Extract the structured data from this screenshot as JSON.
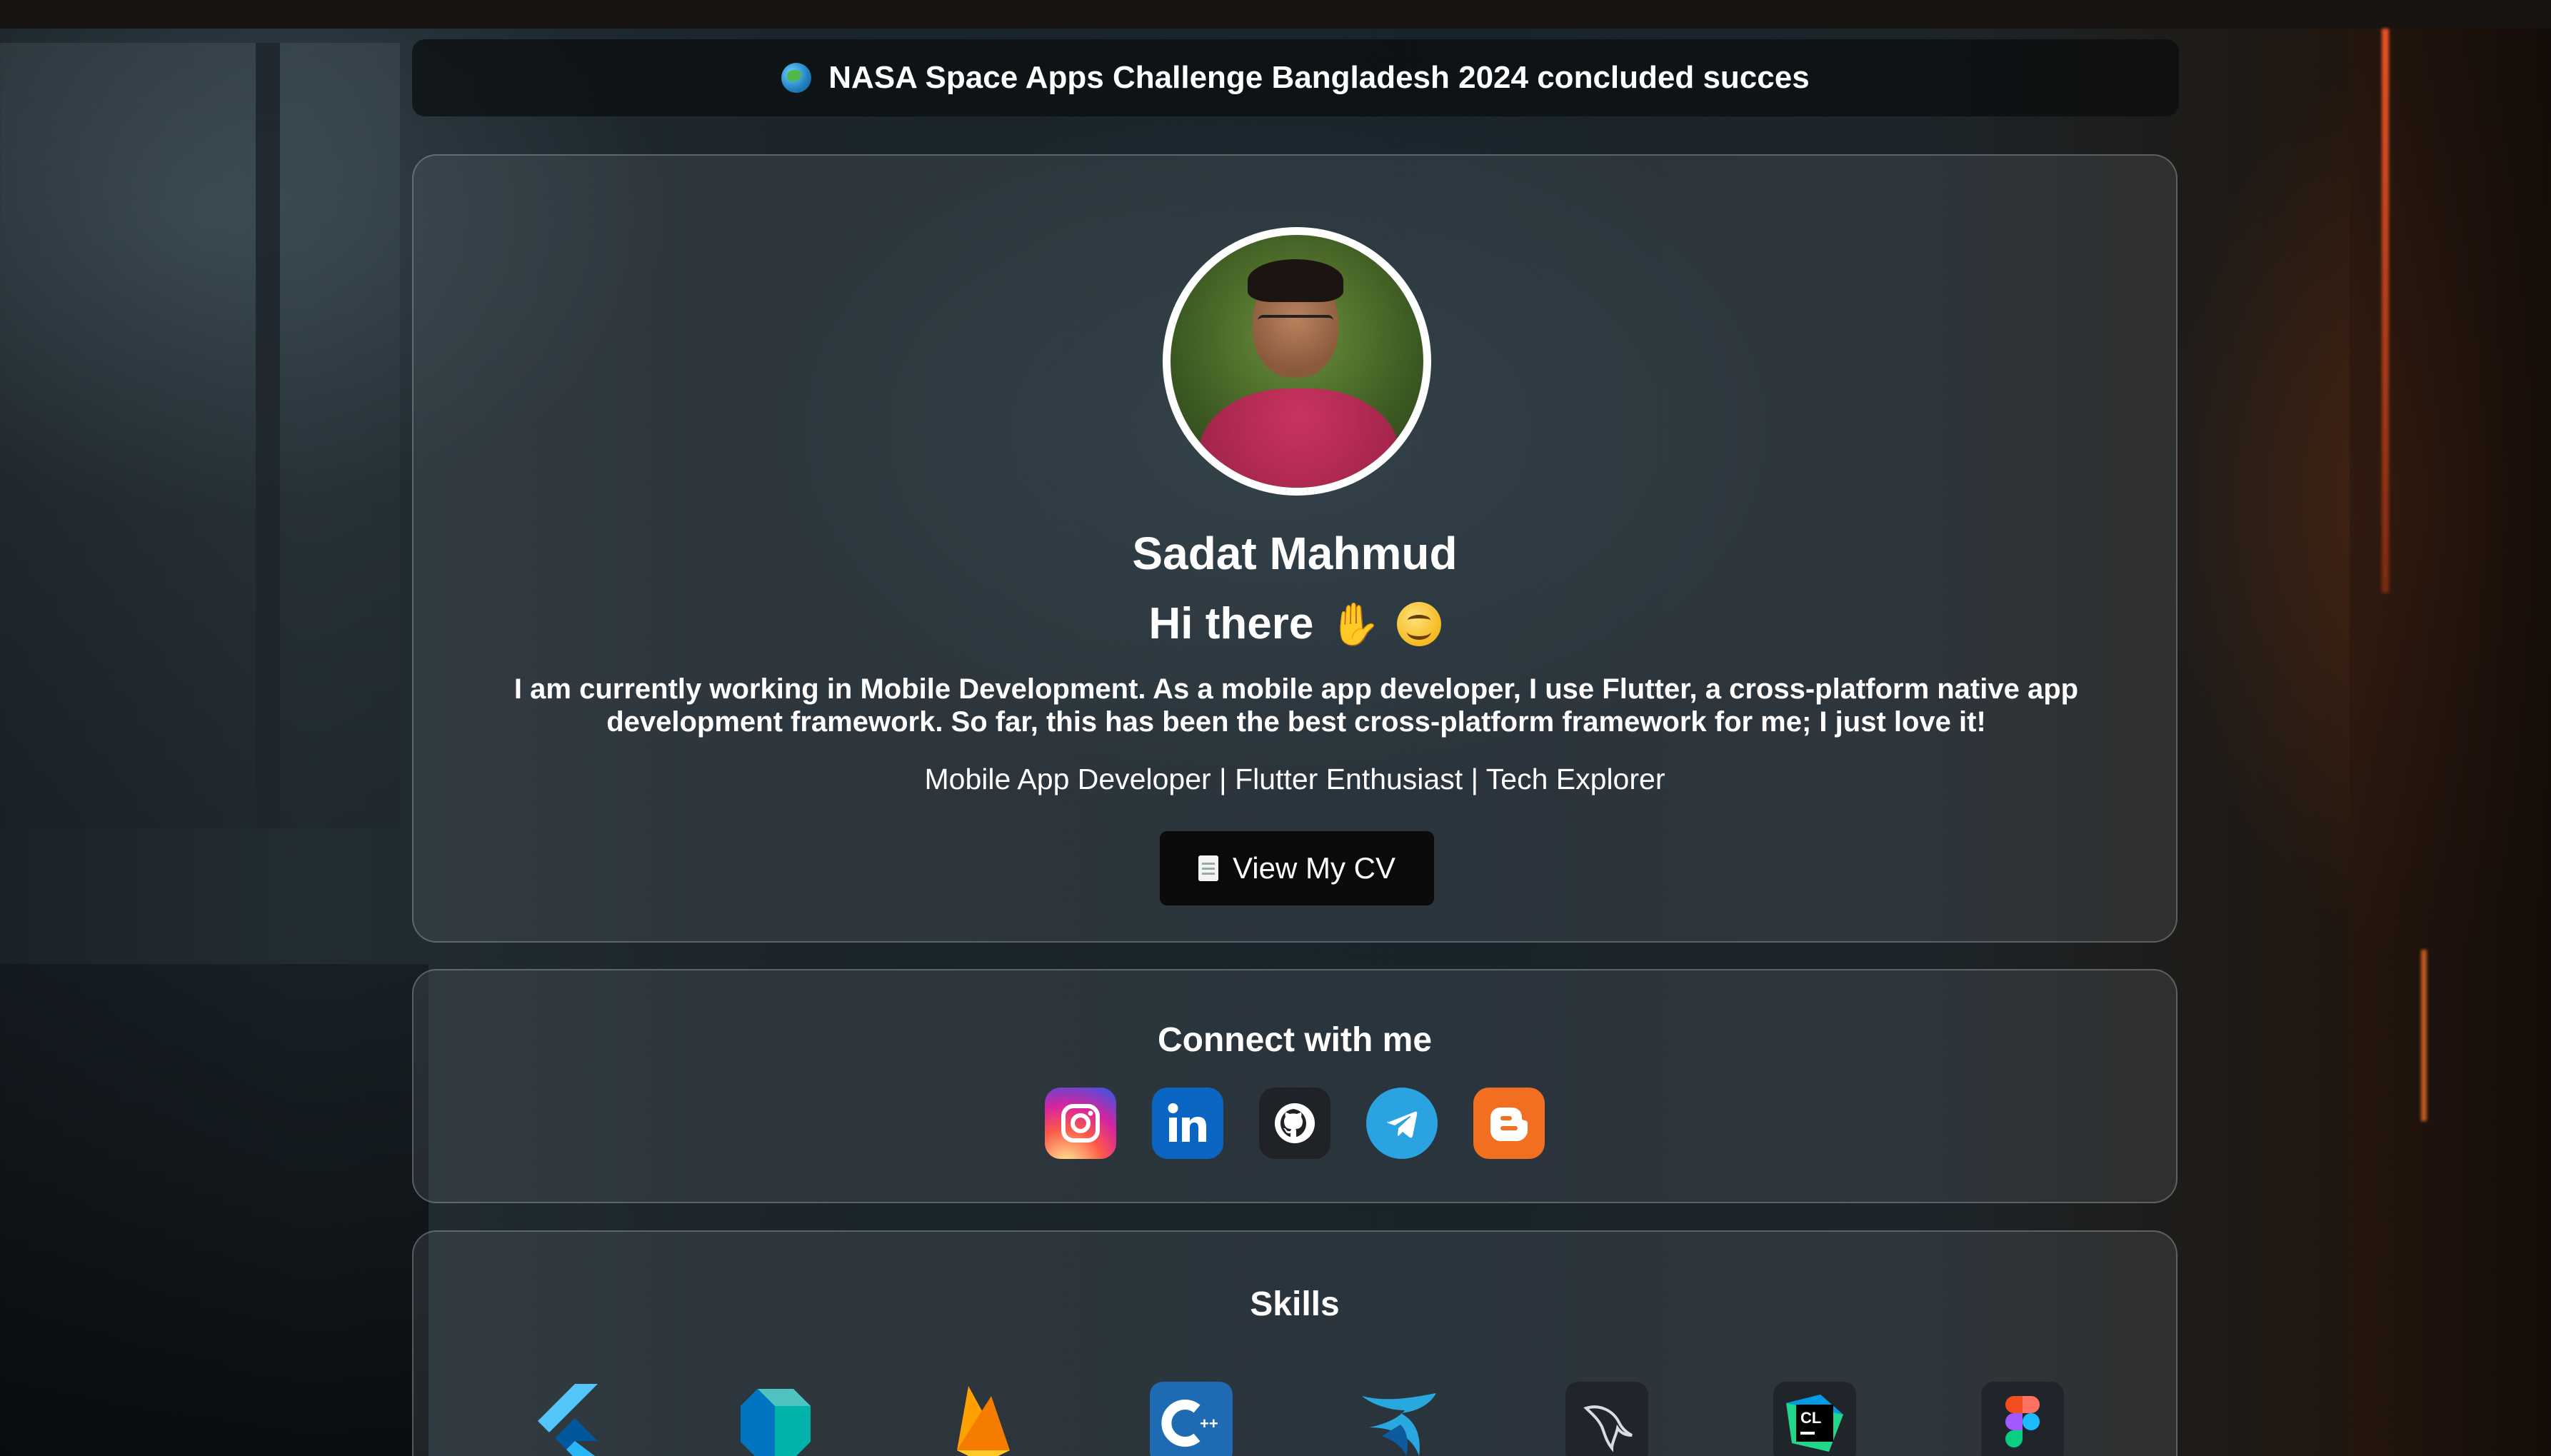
{
  "announcement": {
    "icon": "globe-icon",
    "text": "NASA Space Apps Challenge Bangladesh 2024 concluded succes"
  },
  "profile": {
    "name": "Sadat Mahmud",
    "greeting": "Hi there",
    "greeting_emojis": [
      "waving-hand-icon",
      "smiling-face-icon"
    ],
    "bio": "I am currently working in Mobile Development. As a mobile app developer, I use Flutter, a cross-platform native app development framework. So far, this has been the best cross-platform framework for me; I just love it!",
    "tagline": "Mobile App Developer | Flutter Enthusiast | Tech Explorer",
    "cv_button_label": "View My CV",
    "cv_button_icon": "document-icon"
  },
  "connect": {
    "title": "Connect with me",
    "links": [
      {
        "name": "instagram",
        "icon": "instagram-icon",
        "color": "#d6249f"
      },
      {
        "name": "linkedin",
        "icon": "linkedin-icon",
        "color": "#0a66c2"
      },
      {
        "name": "github",
        "icon": "github-icon",
        "color": "#1f2328"
      },
      {
        "name": "telegram",
        "icon": "telegram-icon",
        "color": "#2aa3e0"
      },
      {
        "name": "blogger",
        "icon": "blogger-icon",
        "color": "#f26f21"
      }
    ]
  },
  "skills": {
    "title": "Skills",
    "items": [
      {
        "name": "flutter",
        "icon": "flutter-icon"
      },
      {
        "name": "dart",
        "icon": "dart-icon"
      },
      {
        "name": "firebase",
        "icon": "firebase-icon"
      },
      {
        "name": "cplusplus",
        "icon": "cplusplus-icon"
      },
      {
        "name": "swift",
        "icon": "swift-icon"
      },
      {
        "name": "mysql",
        "icon": "mysql-icon"
      },
      {
        "name": "clion",
        "icon": "clion-icon"
      },
      {
        "name": "figma",
        "icon": "figma-icon"
      }
    ]
  },
  "colors": {
    "card_background": "#5f697042",
    "announcement_background": "#0a0c0e",
    "button_background": "#0b0b0b",
    "text": "#ffffff"
  }
}
